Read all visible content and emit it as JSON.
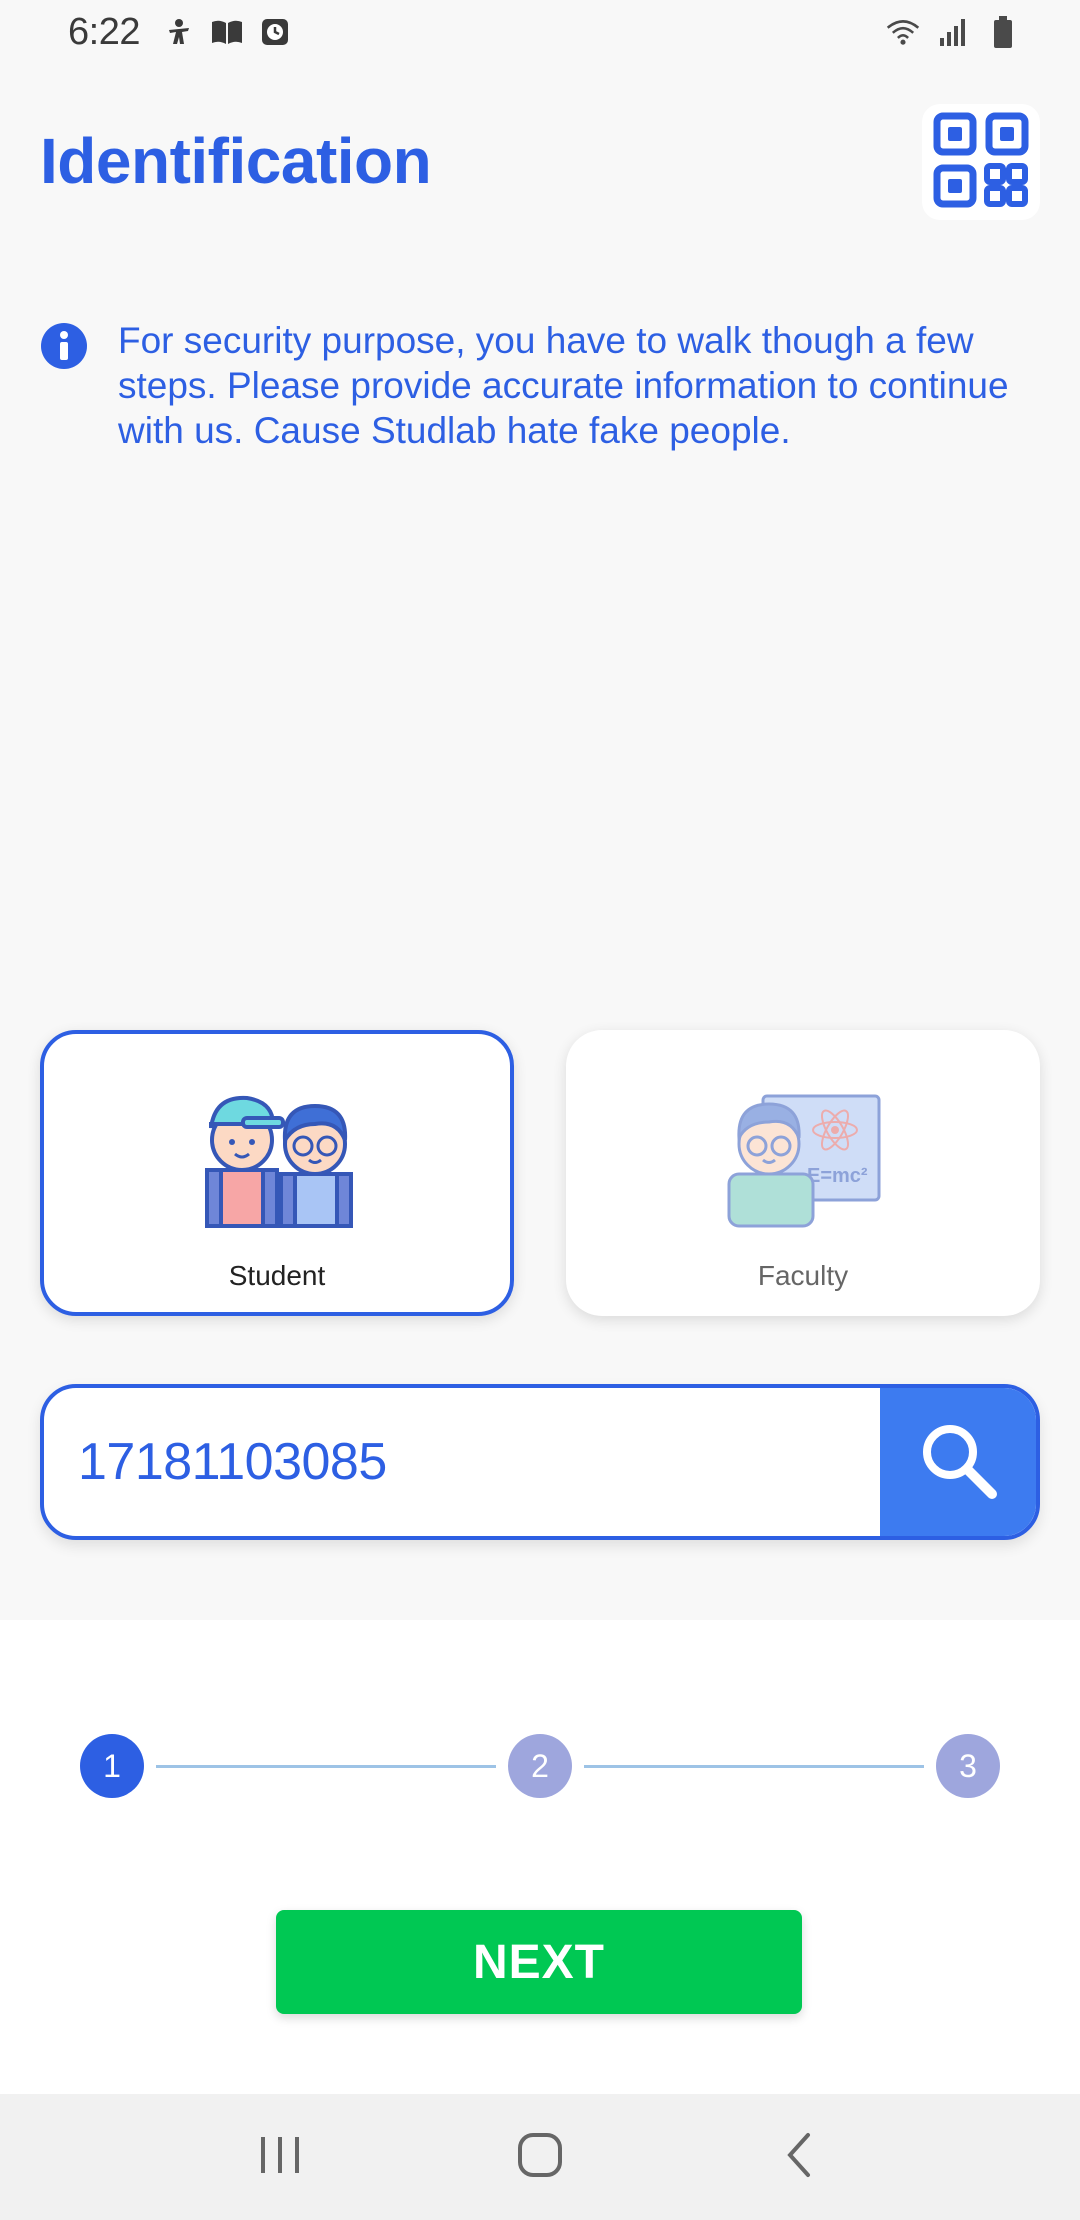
{
  "status_bar": {
    "time": "6:22",
    "left_icons": [
      "accessibility-icon",
      "book-icon",
      "clock-icon"
    ],
    "right_icons": [
      "wifi-icon",
      "signal-icon",
      "battery-icon"
    ]
  },
  "header": {
    "title": "Identification",
    "qr_icon": "qr-code-icon"
  },
  "info": {
    "icon": "info-icon",
    "text": "For security purpose, you have to walk though a few steps. Please provide accurate information to continue with us. Cause Studlab hate fake people."
  },
  "roles": {
    "selected": "student",
    "student": {
      "label": "Student",
      "icon": "students-illustration"
    },
    "faculty": {
      "label": "Faculty",
      "icon": "teacher-illustration"
    }
  },
  "search": {
    "value": "17181103085",
    "icon": "search-icon"
  },
  "stepper": {
    "current": 1,
    "steps": [
      "1",
      "2",
      "3"
    ]
  },
  "next_button": {
    "label": "NEXT"
  },
  "nav_bar": {
    "icons": [
      "recent-apps-icon",
      "home-icon",
      "back-icon"
    ]
  },
  "colors": {
    "primary": "#2d5fe3",
    "search_button": "#3d7bf0",
    "next_button": "#00c853",
    "step_inactive": "#9ea6dd"
  }
}
